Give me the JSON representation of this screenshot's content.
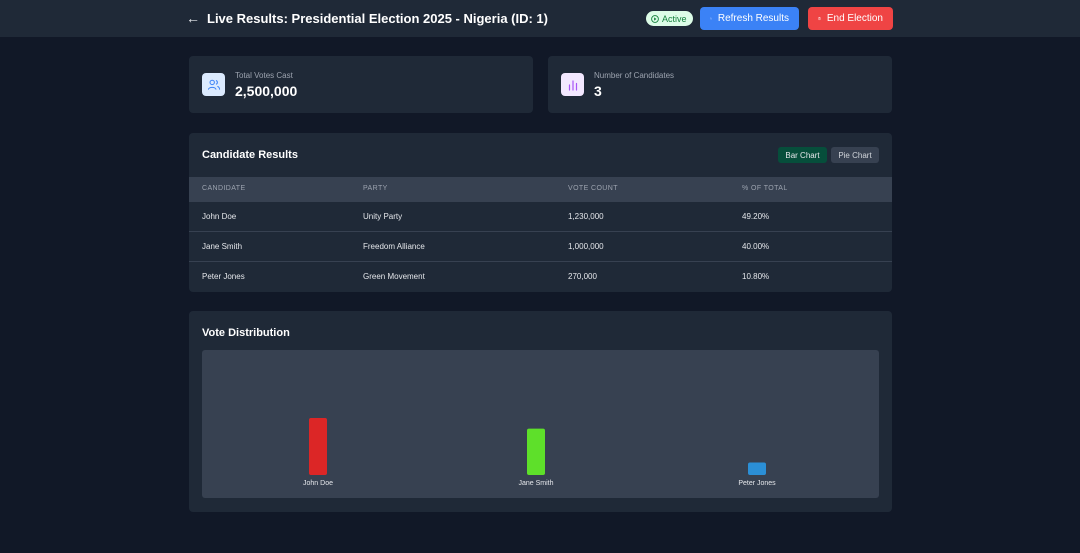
{
  "header": {
    "back_icon": "left-arrow-icon",
    "title": "Live Results: Presidential Election 2025 - Nigeria (ID: 1)",
    "status": "Active",
    "refresh_label": "Refresh Results",
    "end_label": "End Election"
  },
  "stats": {
    "total_votes_label": "Total Votes Cast",
    "total_votes_value": "2,500,000",
    "candidates_label": "Number of Candidates",
    "candidates_value": "3"
  },
  "results": {
    "title": "Candidate Results",
    "bar_chart_label": "Bar Chart",
    "pie_chart_label": "Pie Chart",
    "columns": [
      "CANDIDATE",
      "PARTY",
      "VOTE COUNT",
      "% OF TOTAL"
    ],
    "rows": [
      {
        "candidate": "John Doe",
        "party": "Unity Party",
        "votes": "1,230,000",
        "percent": "49.20%"
      },
      {
        "candidate": "Jane Smith",
        "party": "Freedom Alliance",
        "votes": "1,000,000",
        "percent": "40.00%"
      },
      {
        "candidate": "Peter Jones",
        "party": "Green Movement",
        "votes": "270,000",
        "percent": "10.80%"
      }
    ]
  },
  "distribution": {
    "title": "Vote Distribution"
  },
  "colors": {
    "accent_blue": "#3b82f6",
    "danger_red": "#ef4444",
    "active_green": "#15803d"
  },
  "chart_data": {
    "type": "bar",
    "categories": [
      "John Doe",
      "Jane Smith",
      "Peter Jones"
    ],
    "values": [
      1230000,
      1000000,
      270000
    ],
    "colors": [
      "#dc2626",
      "#5ee02a",
      "#2b8fd6"
    ],
    "grid": false,
    "legend": "none"
  }
}
